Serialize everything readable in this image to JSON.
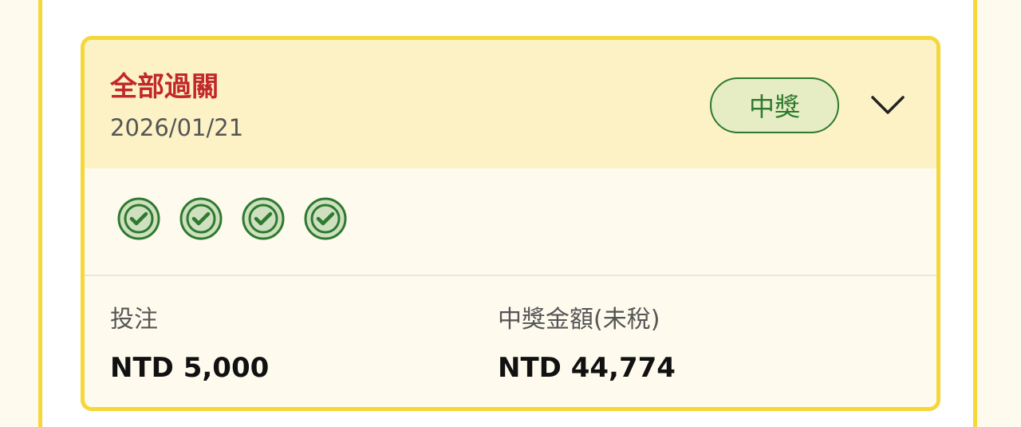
{
  "bet_card": {
    "title": "全部過關",
    "date": "2026/01/21",
    "status": "中獎",
    "expand_icon": "chevron-down-icon",
    "legs": [
      {
        "icon": "check-circle-icon",
        "result": "win"
      },
      {
        "icon": "check-circle-icon",
        "result": "win"
      },
      {
        "icon": "check-circle-icon",
        "result": "win"
      },
      {
        "icon": "check-circle-icon",
        "result": "win"
      }
    ],
    "stake_label": "投注",
    "stake_value": "NTD 5,000",
    "payout_label": "中獎金額(未稅)",
    "payout_value": "NTD 44,774"
  },
  "colors": {
    "accent_border": "#f5d73a",
    "header_bg": "#fcf2c5",
    "title_red": "#c1272d",
    "win_green": "#2d7a2e",
    "badge_bg": "#e6ecc4"
  }
}
